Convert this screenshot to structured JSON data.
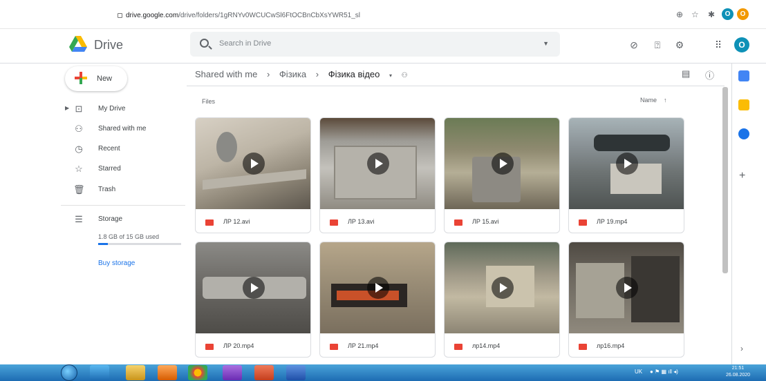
{
  "browser": {
    "back": "←",
    "forward": "→",
    "reload": "C",
    "url_host": "drive.google.com",
    "url_path": "/drive/folders/1gRNYv0WCUCwSl6FtOCBnCbXsYWR51_sl",
    "ext1": "O",
    "ext2": "O"
  },
  "app": {
    "brand": "Drive",
    "search_placeholder": "Search in Drive",
    "avatar": "O"
  },
  "sidebar": {
    "new_label": "New",
    "items": [
      {
        "label": "My Drive",
        "icon": "drive-icon"
      },
      {
        "label": "Shared with me",
        "icon": "people-icon"
      },
      {
        "label": "Recent",
        "icon": "clock-icon"
      },
      {
        "label": "Starred",
        "icon": "star-icon"
      },
      {
        "label": "Trash",
        "icon": "trash-icon"
      }
    ],
    "storage_label": "Storage",
    "storage_used": "1.8 GB of 15 GB used",
    "storage_fraction": 0.12,
    "buy_storage": "Buy storage"
  },
  "breadcrumb": {
    "items": [
      "Shared with me",
      "Фізика",
      "Фізика відео"
    ],
    "sep": "›"
  },
  "main": {
    "section_label": "Files",
    "sort_label": "Name",
    "sort_arrow": "↑"
  },
  "files": [
    {
      "name": "ЛР 12.avi"
    },
    {
      "name": "ЛР 13.avi"
    },
    {
      "name": "ЛР 15.avi"
    },
    {
      "name": "ЛР 19.mp4"
    },
    {
      "name": "ЛР 20.mp4"
    },
    {
      "name": "ЛР 21.mp4"
    },
    {
      "name": "лр14.mp4"
    },
    {
      "name": "лр16.mp4"
    }
  ],
  "taskbar": {
    "lang": "UK",
    "time": "21:51",
    "date": "26.08.2020"
  },
  "colors": {
    "accent": "#1a73e8",
    "file_icon": "#ea4335",
    "taskbar": "#2d7fc4"
  }
}
